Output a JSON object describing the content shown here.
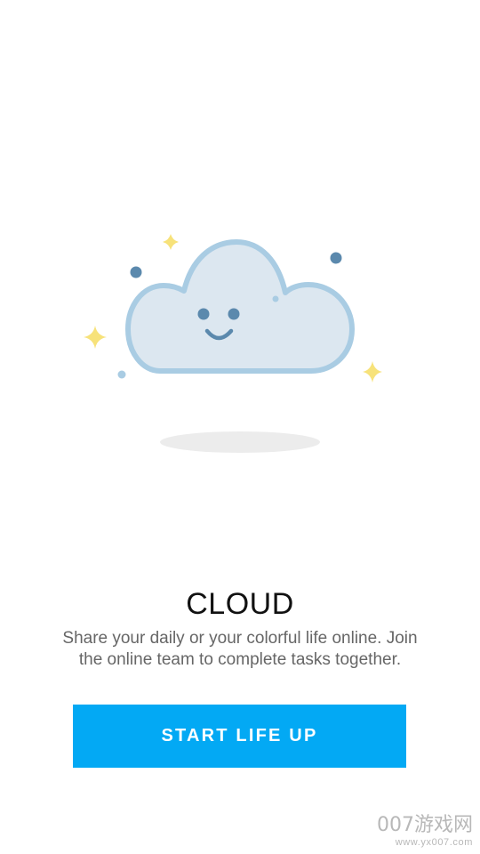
{
  "onboarding": {
    "title": "CLOUD",
    "description": "Share your daily or your colorful life online. Join the online team to complete tasks together.",
    "cta_label": "START LIFE UP"
  },
  "watermark": {
    "brand": "007游戏网",
    "url": "www.yx007.com"
  },
  "colors": {
    "accent": "#03a9f4",
    "cloud_fill": "#dce7f0",
    "cloud_stroke": "#a9cce3",
    "sparkle": "#f7e27a",
    "dot_dark": "#5b89ad"
  },
  "icons": [
    "cloud-illustration",
    "sparkle-icon",
    "dot-icon"
  ]
}
